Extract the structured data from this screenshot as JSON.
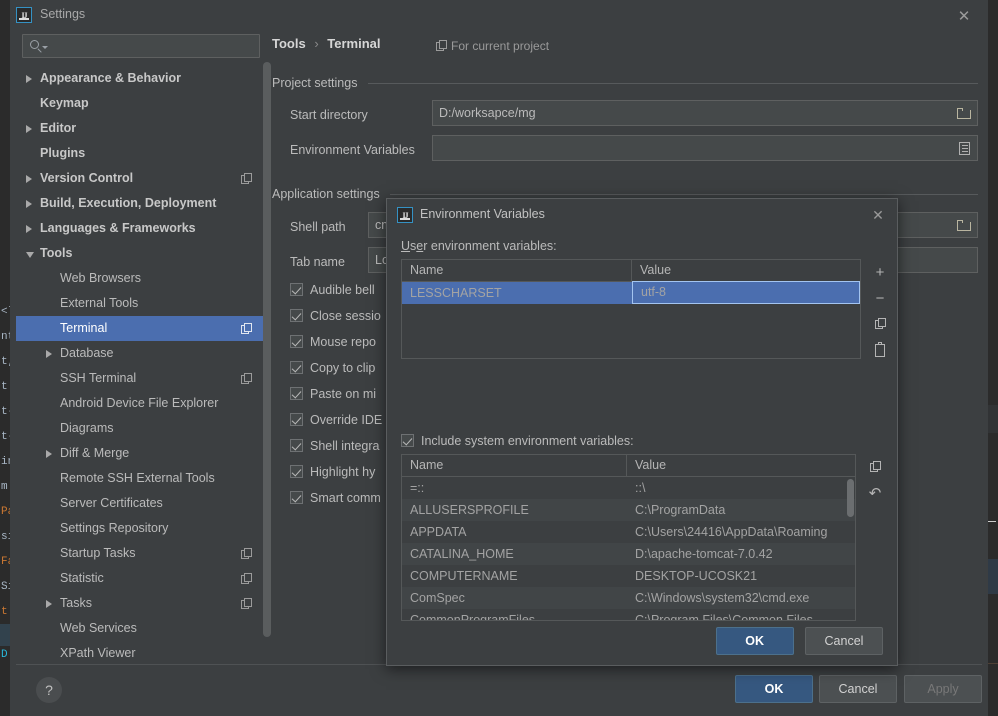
{
  "window": {
    "title": "Settings",
    "icon": "intellij-idea-icon",
    "close_label": "✕"
  },
  "search": {
    "placeholder": "",
    "value": "",
    "icon": "search-icon"
  },
  "sidebar": {
    "items": [
      {
        "label": "Appearance & Behavior",
        "arrow": "collapsed",
        "indent": 0,
        "bold": true,
        "copy": false,
        "selected": false
      },
      {
        "label": "Keymap",
        "arrow": "none",
        "indent": 0,
        "bold": true,
        "copy": false,
        "selected": false
      },
      {
        "label": "Editor",
        "arrow": "collapsed",
        "indent": 0,
        "bold": true,
        "copy": false,
        "selected": false
      },
      {
        "label": "Plugins",
        "arrow": "none",
        "indent": 0,
        "bold": true,
        "copy": false,
        "selected": false
      },
      {
        "label": "Version Control",
        "arrow": "collapsed",
        "indent": 0,
        "bold": true,
        "copy": true,
        "selected": false
      },
      {
        "label": "Build, Execution, Deployment",
        "arrow": "collapsed",
        "indent": 0,
        "bold": true,
        "copy": false,
        "selected": false
      },
      {
        "label": "Languages & Frameworks",
        "arrow": "collapsed",
        "indent": 0,
        "bold": true,
        "copy": false,
        "selected": false
      },
      {
        "label": "Tools",
        "arrow": "expanded",
        "indent": 0,
        "bold": true,
        "copy": false,
        "selected": false
      },
      {
        "label": "Web Browsers",
        "arrow": "none",
        "indent": 1,
        "bold": false,
        "copy": false,
        "selected": false
      },
      {
        "label": "External Tools",
        "arrow": "none",
        "indent": 1,
        "bold": false,
        "copy": false,
        "selected": false
      },
      {
        "label": "Terminal",
        "arrow": "none",
        "indent": 1,
        "bold": false,
        "copy": true,
        "selected": true
      },
      {
        "label": "Database",
        "arrow": "collapsed",
        "indent": 1,
        "bold": false,
        "copy": false,
        "selected": false
      },
      {
        "label": "SSH Terminal",
        "arrow": "none",
        "indent": 1,
        "bold": false,
        "copy": true,
        "selected": false
      },
      {
        "label": "Android Device File Explorer",
        "arrow": "none",
        "indent": 1,
        "bold": false,
        "copy": false,
        "selected": false
      },
      {
        "label": "Diagrams",
        "arrow": "none",
        "indent": 1,
        "bold": false,
        "copy": false,
        "selected": false
      },
      {
        "label": "Diff & Merge",
        "arrow": "collapsed",
        "indent": 1,
        "bold": false,
        "copy": false,
        "selected": false
      },
      {
        "label": "Remote SSH External Tools",
        "arrow": "none",
        "indent": 1,
        "bold": false,
        "copy": false,
        "selected": false
      },
      {
        "label": "Server Certificates",
        "arrow": "none",
        "indent": 1,
        "bold": false,
        "copy": false,
        "selected": false
      },
      {
        "label": "Settings Repository",
        "arrow": "none",
        "indent": 1,
        "bold": false,
        "copy": false,
        "selected": false
      },
      {
        "label": "Startup Tasks",
        "arrow": "none",
        "indent": 1,
        "bold": false,
        "copy": true,
        "selected": false
      },
      {
        "label": "Statistic",
        "arrow": "none",
        "indent": 1,
        "bold": false,
        "copy": true,
        "selected": false
      },
      {
        "label": "Tasks",
        "arrow": "collapsed",
        "indent": 1,
        "bold": false,
        "copy": true,
        "selected": false
      },
      {
        "label": "Web Services",
        "arrow": "none",
        "indent": 1,
        "bold": false,
        "copy": false,
        "selected": false
      },
      {
        "label": "XPath Viewer",
        "arrow": "none",
        "indent": 1,
        "bold": false,
        "copy": false,
        "selected": false
      }
    ]
  },
  "main": {
    "breadcrumb": {
      "parent": "Tools",
      "separator": "›",
      "current": "Terminal"
    },
    "for_current_project": "For current project",
    "project_settings": {
      "title": "Project settings",
      "start_directory_label": "Start directory",
      "start_directory_value": "D:/worksapce/mg",
      "environment_variables_label": "Environment Variables",
      "environment_variables_value": ""
    },
    "application_settings": {
      "title": "Application settings",
      "shell_path_label": "Shell path",
      "shell_path_value": "cm",
      "tab_name_label": "Tab name",
      "tab_name_value": "Loc",
      "checkboxes": [
        {
          "label": "Audible bell",
          "checked": true
        },
        {
          "label": "Close sessio",
          "checked": true
        },
        {
          "label": "Mouse repo",
          "checked": true
        },
        {
          "label": "Copy to clip",
          "checked": true
        },
        {
          "label": "Paste on mi",
          "checked": true
        },
        {
          "label": "Override IDE",
          "checked": true
        },
        {
          "label": "Shell integra",
          "checked": true
        },
        {
          "label": "Highlight hy",
          "checked": true
        },
        {
          "label": "Smart comm",
          "checked": true
        }
      ]
    }
  },
  "bottom_bar": {
    "help_label": "?",
    "ok_label": "OK",
    "cancel_label": "Cancel",
    "apply_label": "Apply"
  },
  "dialog": {
    "title": "Environment Variables",
    "icon": "intellij-idea-icon",
    "close_label": "✕",
    "user_section_label": "User environment variables:",
    "user_table": {
      "headers": [
        "Name",
        "Value"
      ],
      "rows": [
        {
          "name": "LESSCHARSET",
          "value": "utf-8",
          "selected": true
        }
      ]
    },
    "user_tools": [
      {
        "name": "add-variable-button",
        "glyph": "+"
      },
      {
        "name": "remove-variable-button",
        "glyph": "−"
      },
      {
        "name": "copy-variable-button",
        "glyph": "copy-icon"
      },
      {
        "name": "paste-variable-button",
        "glyph": "paste-icon"
      }
    ],
    "include_system": {
      "label": "Include system environment variables:",
      "checked": true
    },
    "system_table": {
      "headers": [
        "Name",
        "Value"
      ],
      "rows": [
        {
          "name": "=::",
          "value": "::\\"
        },
        {
          "name": "ALLUSERSPROFILE",
          "value": "C:\\ProgramData"
        },
        {
          "name": "APPDATA",
          "value": "C:\\Users\\24416\\AppData\\Roaming"
        },
        {
          "name": "CATALINA_HOME",
          "value": "D:\\apache-tomcat-7.0.42"
        },
        {
          "name": "COMPUTERNAME",
          "value": "DESKTOP-UCOSK21"
        },
        {
          "name": "ComSpec",
          "value": "C:\\Windows\\system32\\cmd.exe"
        },
        {
          "name": "CommonProgramFiles",
          "value": "C:\\Program Files\\Common Files"
        }
      ]
    },
    "system_tools": [
      {
        "name": "copy-system-variable-button",
        "glyph": "copy-icon"
      },
      {
        "name": "reset-system-variables-button",
        "glyph": "undo-icon"
      }
    ],
    "ok_label": "OK",
    "cancel_label": "Cancel"
  },
  "colors": {
    "window_bg": "#3c3f41",
    "editor_bg": "#2b2b2b",
    "selection_blue": "#4b6eaf",
    "primary_button": "#365880",
    "field_bg": "#45494a",
    "text": "#bbbbbb"
  }
}
